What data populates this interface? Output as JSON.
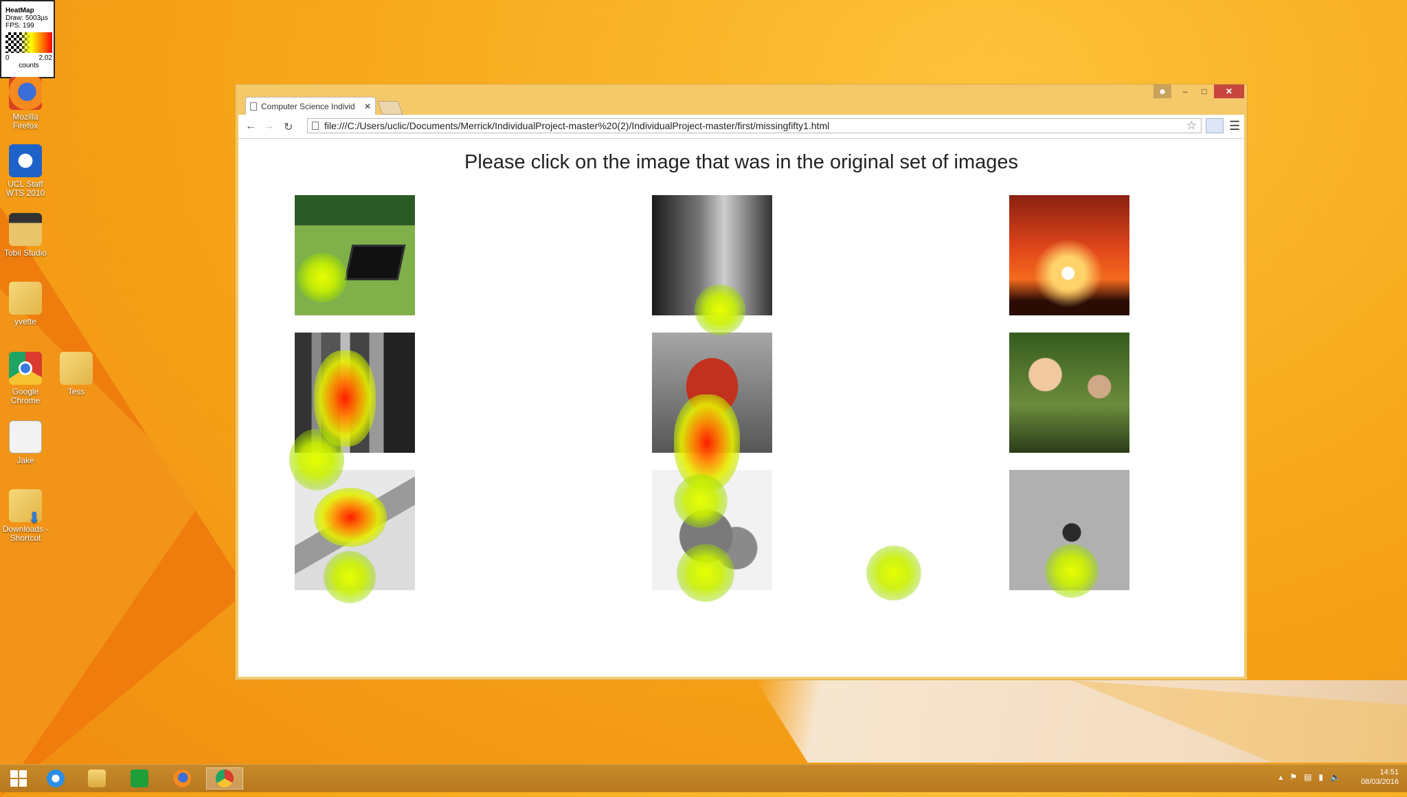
{
  "legend": {
    "title": "HeatMap",
    "draw": "Draw: 5003µs",
    "fps": "FPS: 199",
    "min": "0",
    "max": "2.02",
    "unit": "counts"
  },
  "desktop_icons": [
    {
      "label": "Mozilla Firefox",
      "icon": "firefox-icon"
    },
    {
      "label": "UCL Staff WTS 2010",
      "icon": "remote-desktop-icon"
    },
    {
      "label": "Tobii Studio",
      "icon": "tobii-studio-icon"
    },
    {
      "label": "yvette",
      "icon": "folder-icon"
    },
    {
      "label": "Google Chrome",
      "icon": "chrome-icon"
    },
    {
      "label": "Tess",
      "icon": "folder-icon"
    },
    {
      "label": "Jake",
      "icon": "document-icon"
    },
    {
      "label": "Downloads - Shortcut",
      "icon": "downloads-folder-icon"
    }
  ],
  "browser": {
    "tab_title": "Computer Science Individ",
    "url": "file:///C:/Users/uclic/Documents/Merrick/IndividualProject-master%20(2)/IndividualProject-master/first/missingfifty1.html",
    "window_controls": {
      "minimize": "–",
      "maximize": "□",
      "close": "✕"
    }
  },
  "page": {
    "heading": "Please click on the image that was in the original set of images",
    "images": [
      {
        "subject": "laptop-on-grass"
      },
      {
        "subject": "glass-jars"
      },
      {
        "subject": "sunset"
      },
      {
        "subject": "city-skyline"
      },
      {
        "subject": "crab"
      },
      {
        "subject": "toy-figures"
      },
      {
        "subject": "open-book"
      },
      {
        "subject": "mandarins"
      },
      {
        "subject": "bug"
      }
    ]
  },
  "taskbar": {
    "items": [
      "start-icon",
      "internet-explorer-icon",
      "file-explorer-icon",
      "store-icon",
      "firefox-icon",
      "chrome-icon"
    ],
    "time": "14:51",
    "date": "08/03/2016"
  },
  "colors": {
    "heat_low": "#c8f000",
    "heat_high": "#ff1e00",
    "window_frame": "#f5c86a",
    "close_button": "#c7463e"
  }
}
